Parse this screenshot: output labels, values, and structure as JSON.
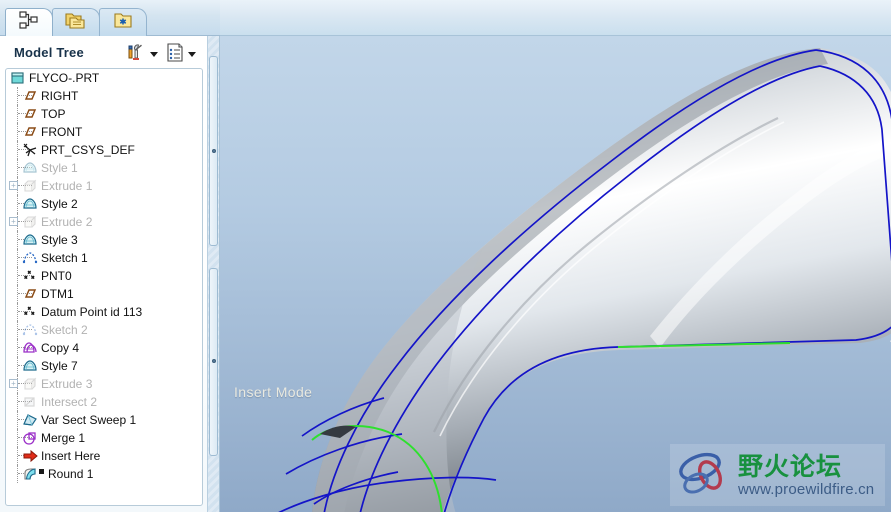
{
  "tabs": [
    {
      "name": "model-tree-tab",
      "icon": "model-tree-icon",
      "title": "Model Tree",
      "active": true
    },
    {
      "name": "folder-browser-tab",
      "icon": "folder-browser-icon",
      "title": "Folder Browser",
      "active": false
    },
    {
      "name": "favorites-tab",
      "icon": "favorites-folder-icon",
      "title": "Favorites",
      "active": false
    }
  ],
  "panel": {
    "title": "Model Tree",
    "tools": [
      {
        "name": "settings-tools-button",
        "icon": "tools-icon",
        "label": ""
      },
      {
        "name": "display-settings-button",
        "icon": "list-document-icon",
        "label": ""
      }
    ]
  },
  "tree": [
    {
      "label": "FLYCO-.PRT",
      "icon": "part-icon",
      "depth": 0,
      "dim": false,
      "expander": "none"
    },
    {
      "label": "RIGHT",
      "icon": "datum-plane-icon",
      "depth": 1,
      "dim": false,
      "expander": "none"
    },
    {
      "label": "TOP",
      "icon": "datum-plane-icon",
      "depth": 1,
      "dim": false,
      "expander": "none"
    },
    {
      "label": "FRONT",
      "icon": "datum-plane-icon",
      "depth": 1,
      "dim": false,
      "expander": "none"
    },
    {
      "label": "PRT_CSYS_DEF",
      "icon": "coord-system-icon",
      "depth": 1,
      "dim": false,
      "expander": "none"
    },
    {
      "label": "Style 1",
      "icon": "style-icon",
      "depth": 1,
      "dim": true,
      "expander": "none"
    },
    {
      "label": "Extrude 1",
      "icon": "extrude-icon",
      "depth": 1,
      "dim": true,
      "expander": "plus"
    },
    {
      "label": "Style 2",
      "icon": "style-icon",
      "depth": 1,
      "dim": false,
      "expander": "none"
    },
    {
      "label": "Extrude 2",
      "icon": "extrude-icon",
      "depth": 1,
      "dim": true,
      "expander": "plus"
    },
    {
      "label": "Style 3",
      "icon": "style-icon",
      "depth": 1,
      "dim": false,
      "expander": "none"
    },
    {
      "label": "Sketch 1",
      "icon": "sketch-icon",
      "depth": 1,
      "dim": false,
      "expander": "none"
    },
    {
      "label": "PNT0",
      "icon": "datum-point-icon",
      "depth": 1,
      "dim": false,
      "expander": "none"
    },
    {
      "label": "DTM1",
      "icon": "datum-plane-icon",
      "depth": 1,
      "dim": false,
      "expander": "none"
    },
    {
      "label": "Datum Point id 113",
      "icon": "datum-point-icon",
      "depth": 1,
      "dim": false,
      "expander": "none"
    },
    {
      "label": "Sketch 2",
      "icon": "sketch-icon",
      "depth": 1,
      "dim": true,
      "expander": "none"
    },
    {
      "label": "Copy 4",
      "icon": "copy-surface-icon",
      "depth": 1,
      "dim": false,
      "expander": "none"
    },
    {
      "label": "Style 7",
      "icon": "style-icon",
      "depth": 1,
      "dim": false,
      "expander": "none"
    },
    {
      "label": "Extrude 3",
      "icon": "extrude-icon",
      "depth": 1,
      "dim": true,
      "expander": "plus"
    },
    {
      "label": "Intersect 2",
      "icon": "intersect-icon",
      "depth": 1,
      "dim": true,
      "expander": "none"
    },
    {
      "label": "Var Sect Sweep 1",
      "icon": "sweep-icon",
      "depth": 1,
      "dim": false,
      "expander": "none"
    },
    {
      "label": "Merge 1",
      "icon": "merge-icon",
      "depth": 1,
      "dim": false,
      "expander": "none"
    },
    {
      "label": "Insert Here",
      "icon": "insert-here-arrow-icon",
      "depth": 1,
      "dim": false,
      "expander": "none"
    },
    {
      "label": "Round 1",
      "icon": "round-icon",
      "depth": 1,
      "dim": false,
      "expander": "none"
    }
  ],
  "viewport": {
    "status_text": "Insert Mode",
    "background_top": "#c2d6e9",
    "background_bottom": "#8fa9c8",
    "model_edge_color": "#1414c8",
    "highlight_curve_color": "#2ee02e",
    "surface_light": "#ffffff",
    "surface_dark": "#5e656c"
  },
  "watermark": {
    "title_cn": "野火论坛",
    "url": "www.proewildfire.cn",
    "title_color": "#18913f",
    "url_color": "#3c5c86"
  }
}
